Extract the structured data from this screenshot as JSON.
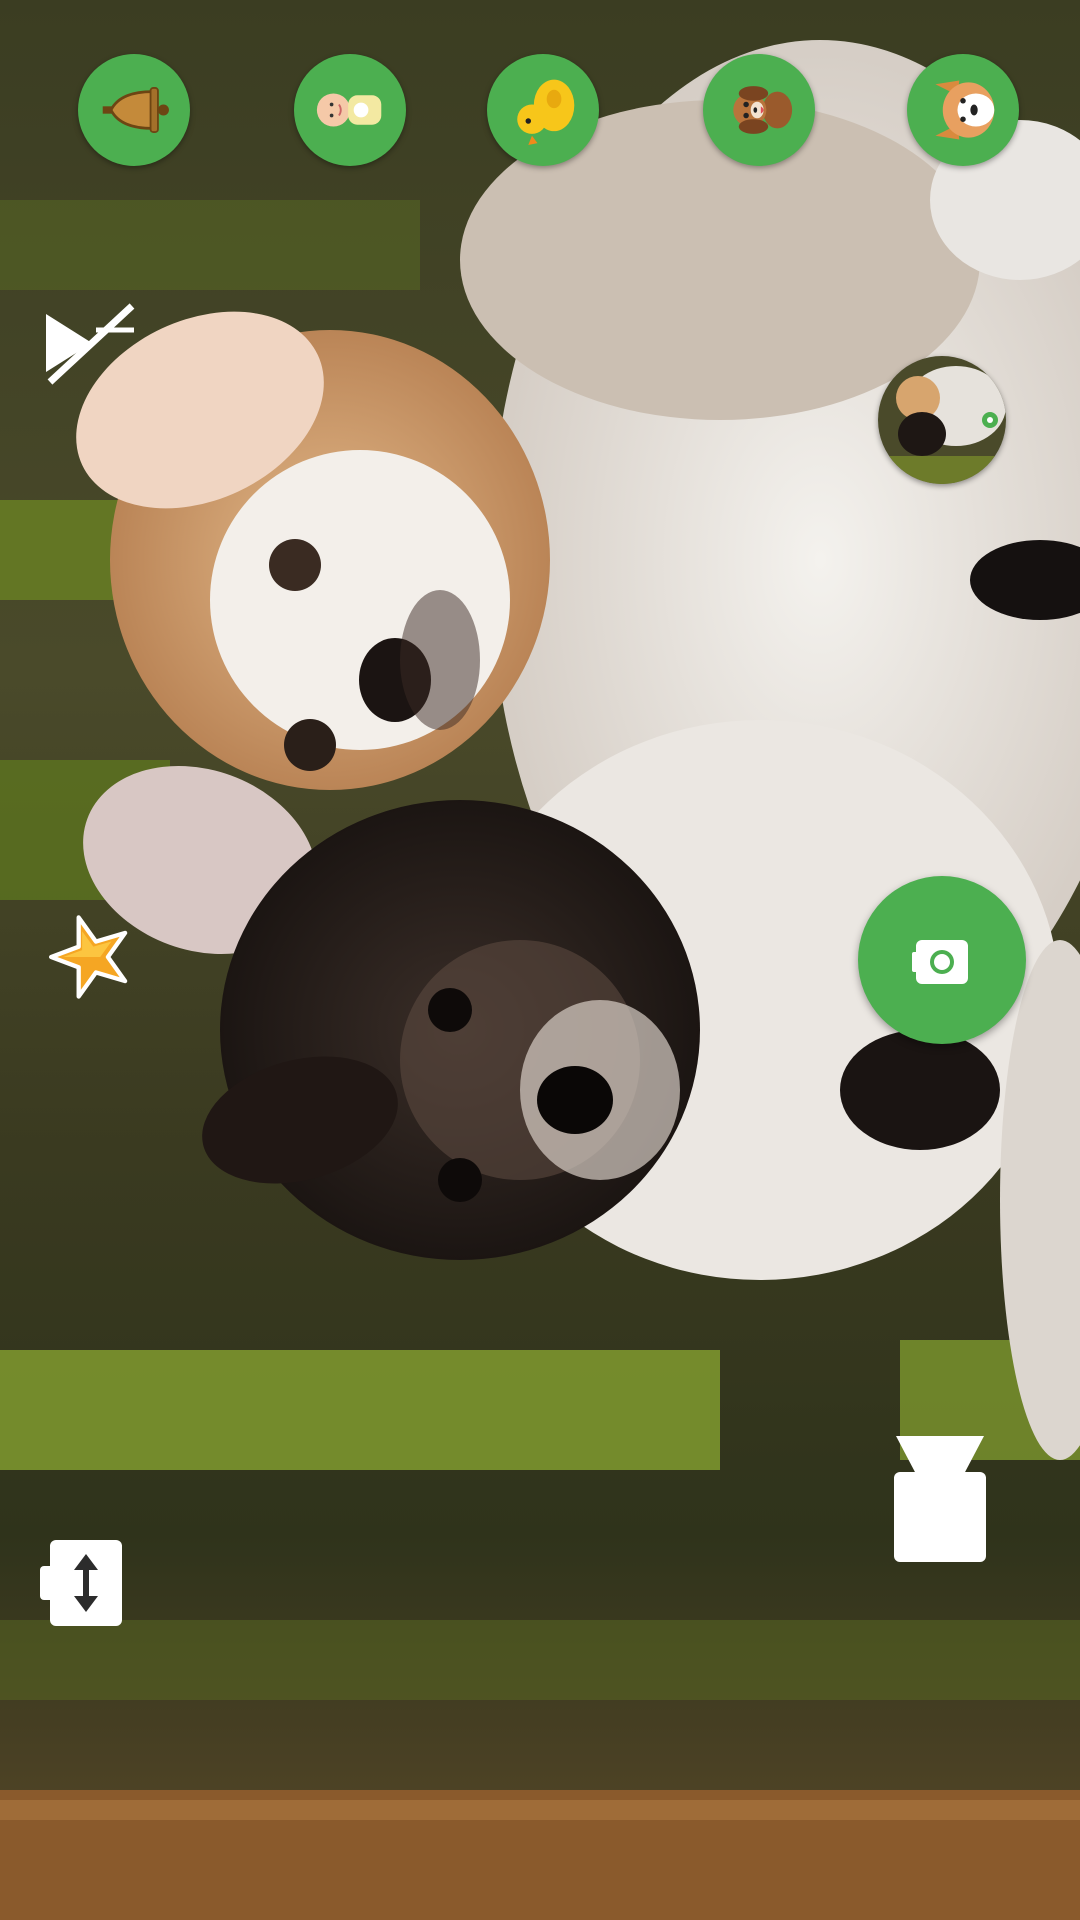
{
  "sound_buttons": [
    {
      "name": "bell-icon"
    },
    {
      "name": "baby-icon"
    },
    {
      "name": "duck-icon"
    },
    {
      "name": "dog-icon"
    },
    {
      "name": "corgi-icon"
    }
  ],
  "controls": {
    "mute_icon": "mute-icon",
    "star_icon": "star-icon",
    "shutter_icon": "camera-icon",
    "switch_icon": "switch-camera-icon",
    "flash_icon": "flash-icon",
    "gallery": "gallery-thumbnail"
  },
  "colors": {
    "accent": "#4caf50",
    "icon_white": "#ffffff",
    "star": "#f5a623"
  }
}
